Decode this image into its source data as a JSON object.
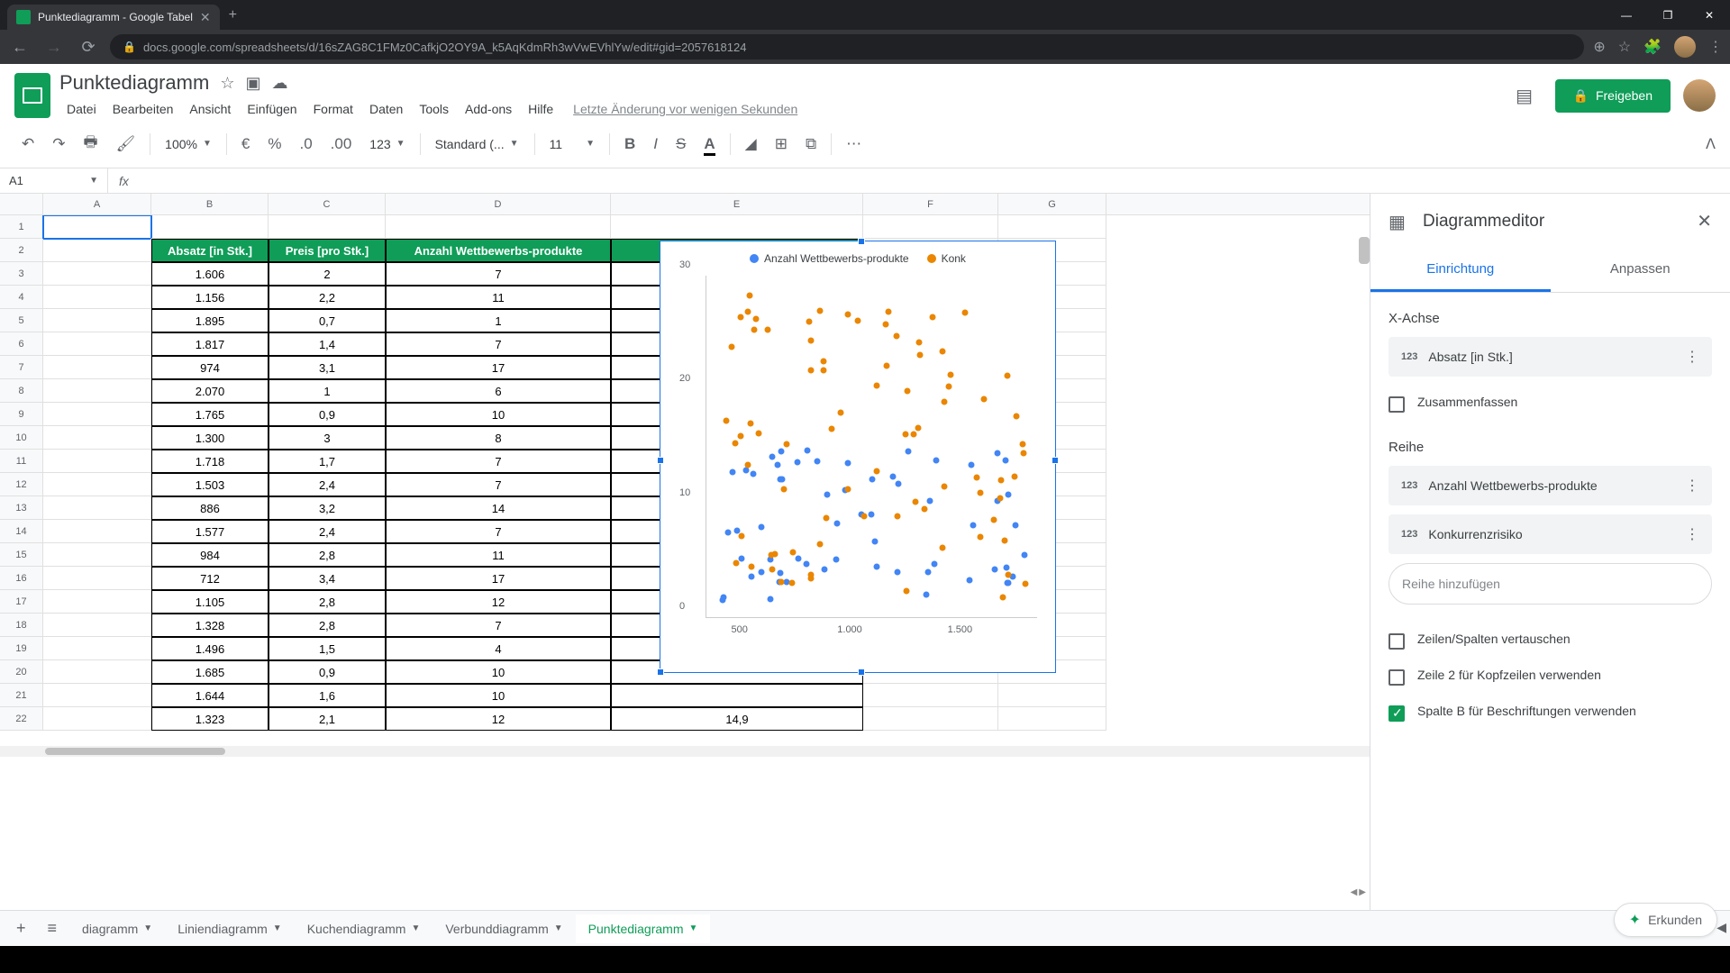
{
  "browser": {
    "tab_title": "Punktediagramm - Google Tabel",
    "url": "docs.google.com/spreadsheets/d/16sZAG8C1FMz0CafkjO2OY9A_k5AqKdmRh3wVwEVhlYw/edit#gid=2057618124"
  },
  "doc": {
    "title": "Punktediagramm",
    "last_edit": "Letzte Änderung vor wenigen Sekunden"
  },
  "menu": [
    "Datei",
    "Bearbeiten",
    "Ansicht",
    "Einfügen",
    "Format",
    "Daten",
    "Tools",
    "Add-ons",
    "Hilfe"
  ],
  "toolbar": {
    "zoom": "100%",
    "font": "Standard (...",
    "size": "11"
  },
  "share": "Freigeben",
  "name_box": "A1",
  "columns": [
    "A",
    "B",
    "C",
    "D",
    "E",
    "F",
    "G"
  ],
  "headers": {
    "B": "Absatz [in Stk.]",
    "C": "Preis [pro Stk.]",
    "D": "Anzahl Wettbewerbs-produkte",
    "E": "Konkurrenzrisiko"
  },
  "rows": [
    {
      "n": 1
    },
    {
      "n": 2,
      "h": true
    },
    {
      "n": 3,
      "b": "1.606",
      "c": "2",
      "d": "7"
    },
    {
      "n": 4,
      "b": "1.156",
      "c": "2,2",
      "d": "11"
    },
    {
      "n": 5,
      "b": "1.895",
      "c": "0,7",
      "d": "1"
    },
    {
      "n": 6,
      "b": "1.817",
      "c": "1,4",
      "d": "7"
    },
    {
      "n": 7,
      "b": "974",
      "c": "3,1",
      "d": "17"
    },
    {
      "n": 8,
      "b": "2.070",
      "c": "1",
      "d": "6"
    },
    {
      "n": 9,
      "b": "1.765",
      "c": "0,9",
      "d": "10"
    },
    {
      "n": 10,
      "b": "1.300",
      "c": "3",
      "d": "8"
    },
    {
      "n": 11,
      "b": "1.718",
      "c": "1,7",
      "d": "7"
    },
    {
      "n": 12,
      "b": "1.503",
      "c": "2,4",
      "d": "7"
    },
    {
      "n": 13,
      "b": "886",
      "c": "3,2",
      "d": "14"
    },
    {
      "n": 14,
      "b": "1.577",
      "c": "2,4",
      "d": "7"
    },
    {
      "n": 15,
      "b": "984",
      "c": "2,8",
      "d": "11"
    },
    {
      "n": 16,
      "b": "712",
      "c": "3,4",
      "d": "17"
    },
    {
      "n": 17,
      "b": "1.105",
      "c": "2,8",
      "d": "12"
    },
    {
      "n": 18,
      "b": "1.328",
      "c": "2,8",
      "d": "7"
    },
    {
      "n": 19,
      "b": "1.496",
      "c": "1,5",
      "d": "4"
    },
    {
      "n": 20,
      "b": "1.685",
      "c": "0,9",
      "d": "10"
    },
    {
      "n": 21,
      "b": "1.644",
      "c": "1,6",
      "d": "10"
    },
    {
      "n": 22,
      "b": "1.323",
      "c": "2,1",
      "d": "12",
      "e": "14,9"
    }
  ],
  "chart": {
    "legend": [
      "Anzahl Wettbewerbs-produkte",
      "Konk"
    ],
    "colors": [
      "#4285f4",
      "#ea8600"
    ],
    "y_ticks": [
      0,
      10,
      20,
      30
    ],
    "x_ticks": [
      500,
      "1.000",
      "1.500"
    ]
  },
  "editor": {
    "title": "Diagrammeditor",
    "tabs": [
      "Einrichtung",
      "Anpassen"
    ],
    "x_axis_label": "X-Achse",
    "x_axis_field": "Absatz [in Stk.]",
    "aggregate": "Zusammenfassen",
    "series_label": "Reihe",
    "series": [
      "Anzahl Wettbewerbs-produkte",
      "Konkurrenzrisiko"
    ],
    "add_series": "Reihe hinzufügen",
    "switch_rc": "Zeilen/Spalten vertauschen",
    "row2_headers": "Zeile 2 für Kopfzeilen verwenden",
    "col_b_labels": "Spalte B für Beschriftungen verwenden"
  },
  "sheets": {
    "tabs": [
      "diagramm",
      "Liniendiagramm",
      "Kuchendiagramm",
      "Verbunddiagramm",
      "Punktediagramm"
    ],
    "active": 4,
    "explore": "Erkunden"
  },
  "chart_data": {
    "type": "scatter",
    "xlabel": "Absatz [in Stk.]",
    "x_range": [
      400,
      1800
    ],
    "y_range": [
      0,
      30
    ],
    "series": [
      {
        "name": "Anzahl Wettbewerbs-produkte",
        "color": "#4285f4"
      },
      {
        "name": "Konkurrenzrisiko",
        "color": "#ea8600"
      }
    ],
    "note": "Dense scatter plot; blue series clusters 1-17 on y-axis declining with x; orange series spans 2-29 broadly distributed"
  }
}
